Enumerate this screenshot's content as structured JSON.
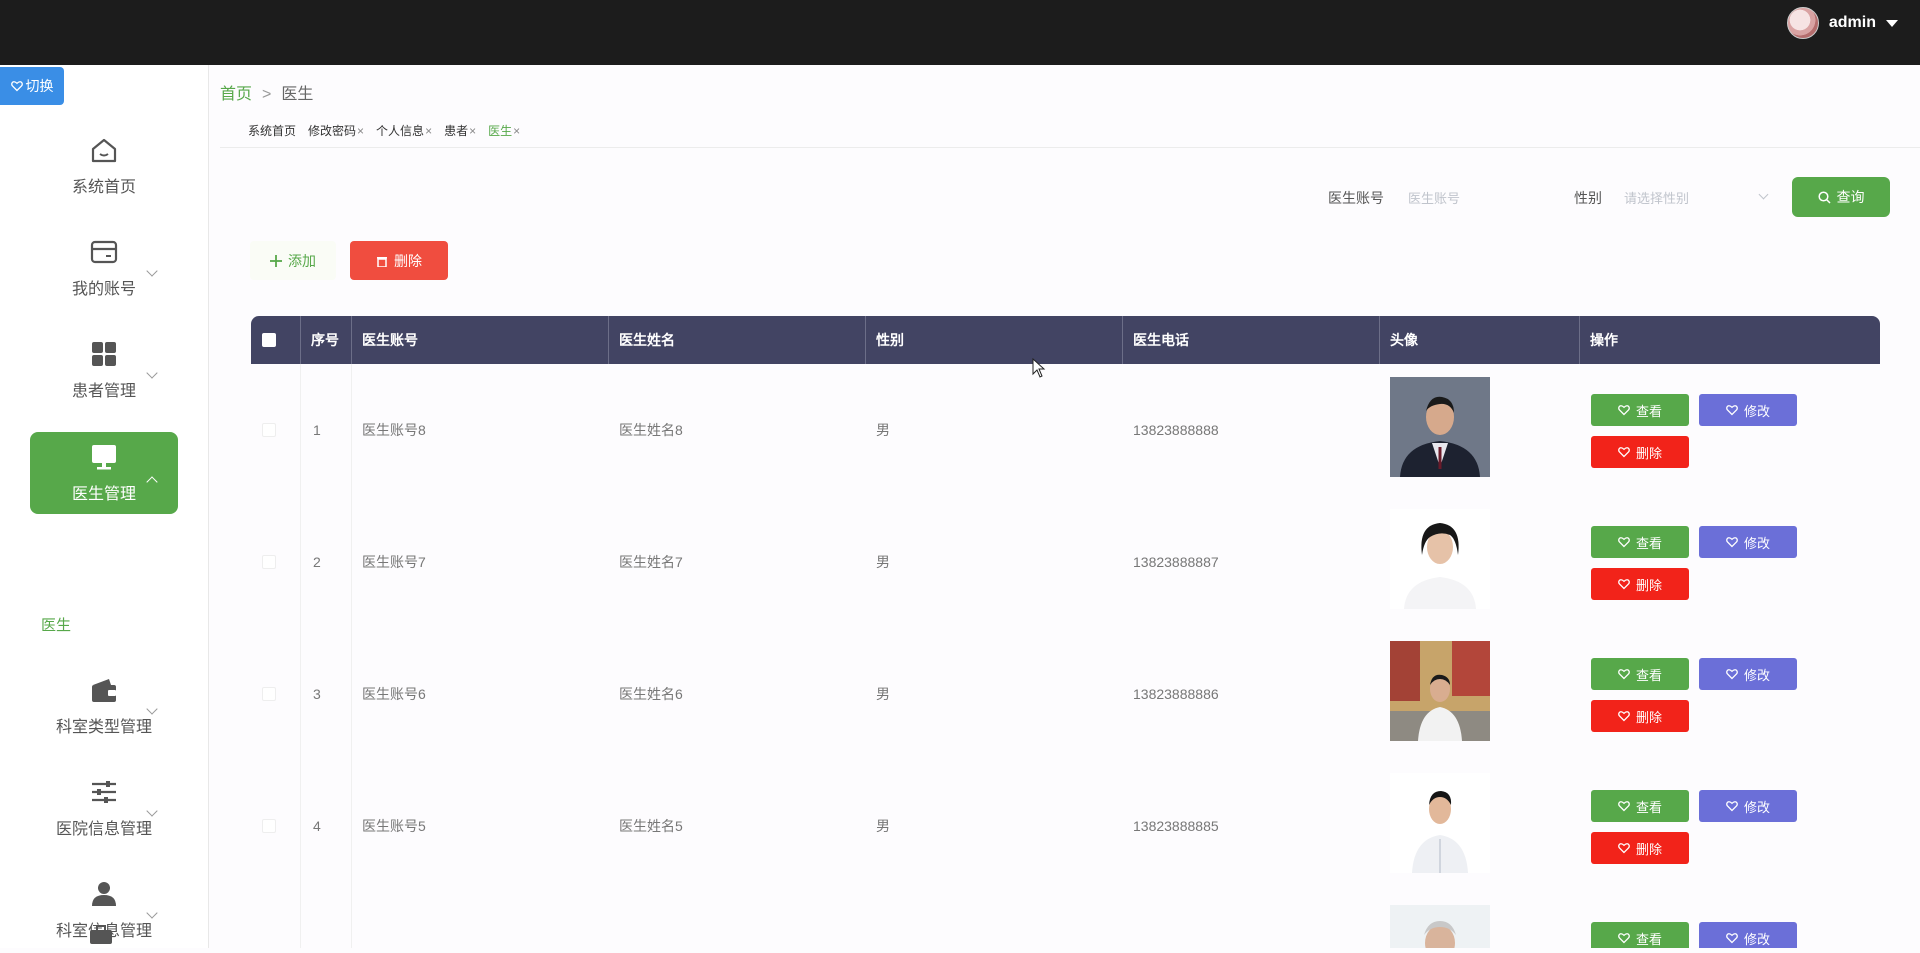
{
  "header": {
    "username": "admin"
  },
  "switch_label": "切换",
  "sidebar": {
    "items": [
      {
        "label": "系统首页",
        "icon": "home-icon"
      },
      {
        "label": "我的账号",
        "icon": "card-icon"
      },
      {
        "label": "患者管理",
        "icon": "grid-icon"
      },
      {
        "label": "医生管理",
        "icon": "monitor-icon",
        "active": true
      },
      {
        "label": "科室类型管理",
        "icon": "wallet-icon"
      },
      {
        "label": "医院信息管理",
        "icon": "sliders-icon"
      },
      {
        "label": "科室信息管理",
        "icon": "user-icon"
      }
    ],
    "submenu": "医生"
  },
  "breadcrumb": {
    "home": "首页",
    "separator": ">",
    "current": "医生"
  },
  "tabs": [
    {
      "label": "系统首页",
      "closable": false
    },
    {
      "label": "修改密码",
      "closable": true
    },
    {
      "label": "个人信息",
      "closable": true
    },
    {
      "label": "患者",
      "closable": true
    },
    {
      "label": "医生",
      "closable": true,
      "active": true
    }
  ],
  "tab_close": "×",
  "search": {
    "account_label": "医生账号",
    "account_placeholder": "医生账号",
    "gender_label": "性别",
    "gender_placeholder": "请选择性别",
    "query_label": "查询"
  },
  "toolbar": {
    "add_label": "添加",
    "delete_label": "删除"
  },
  "table": {
    "headers": [
      "序号",
      "医生账号",
      "医生姓名",
      "性别",
      "医生电话",
      "头像",
      "操作"
    ],
    "rows": [
      {
        "index": "1",
        "account": "医生账号8",
        "name": "医生姓名8",
        "gender": "男",
        "phone": "13823888888"
      },
      {
        "index": "2",
        "account": "医生账号7",
        "name": "医生姓名7",
        "gender": "男",
        "phone": "13823888887"
      },
      {
        "index": "3",
        "account": "医生账号6",
        "name": "医生姓名6",
        "gender": "男",
        "phone": "13823888886"
      },
      {
        "index": "4",
        "account": "医生账号5",
        "name": "医生姓名5",
        "gender": "男",
        "phone": "13823888885"
      },
      {
        "index": "",
        "account": "",
        "name": "",
        "gender": "",
        "phone": ""
      }
    ],
    "actions": {
      "view": "查看",
      "edit": "修改",
      "delete": "删除"
    }
  },
  "colors": {
    "accent": "#57a84a",
    "header_bg": "#424463",
    "danger": "#f2231a",
    "edit": "#6b6fd8"
  }
}
